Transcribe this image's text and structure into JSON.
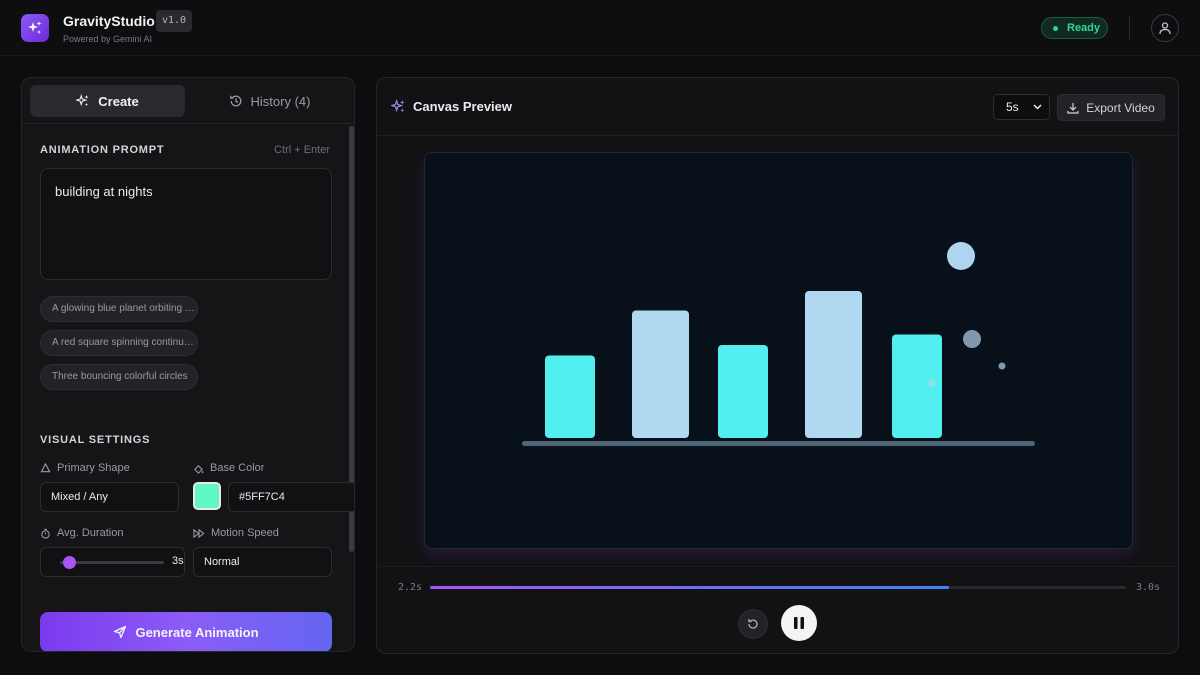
{
  "app": {
    "title": "GravityStudio",
    "subtitle": "Powered by Gemini AI",
    "version": "v1.0",
    "status": "Ready",
    "accent": "#8b5cf6"
  },
  "tabs": [
    {
      "label": "Create",
      "active": true,
      "icon": "sparkles-icon"
    },
    {
      "label": "History (4)",
      "active": false,
      "icon": "history-icon"
    }
  ],
  "prompt": {
    "section_label": "ANIMATION PROMPT",
    "shortcut": "Ctrl + Enter",
    "value": "building at nights",
    "suggestions": [
      "A glowing blue planet orbiting a sun",
      "A red square spinning continuously",
      "Three bouncing colorful circles"
    ]
  },
  "settings": {
    "section_label": "VISUAL SETTINGS",
    "primary_shape_label": "Primary Shape",
    "primary_shape_value": "Mixed / Any",
    "base_color_label": "Base Color",
    "base_color_value": "#5FF7C4",
    "avg_duration_label": "Avg. Duration",
    "avg_duration_value": "3s",
    "avg_duration_fraction": 0.1,
    "motion_speed_label": "Motion Speed",
    "motion_speed_value": "Normal"
  },
  "generate_label": "Generate Animation",
  "preview": {
    "title": "Canvas Preview",
    "duration_option": "5s",
    "export_label": "Export Video",
    "bar_colors": [
      "#53eef0",
      "#b0d8f0"
    ],
    "bars": [
      {
        "value": 0.55,
        "color": "#53eef0"
      },
      {
        "value": 0.85,
        "color": "#b0d8f0"
      },
      {
        "value": 0.62,
        "color": "#53eef0"
      },
      {
        "value": 0.98,
        "color": "#b0d8f0"
      },
      {
        "value": 0.69,
        "color": "#53eef0"
      }
    ]
  },
  "timeline": {
    "current": "2.2s",
    "total": "3.0s",
    "progress": 0.746
  }
}
